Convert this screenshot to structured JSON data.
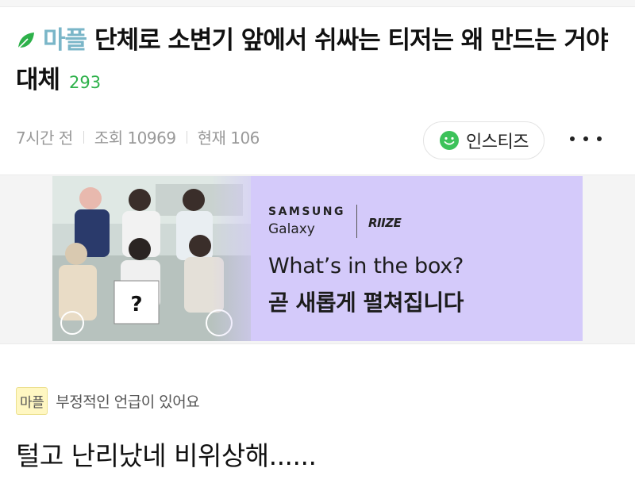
{
  "post": {
    "category": "마플",
    "title": "단체로 소변기 앞에서 쉬싸는 티저는 왜 만드는 거야 대체",
    "comment_count": "293",
    "meta": {
      "time": "7시간 전",
      "views": "조회 10969",
      "current": "현재 106"
    },
    "board_badge": "인스티즈",
    "notice_tag": "마플",
    "notice_text": "부정적인 언급이 있어요",
    "body": "털고 난리났네 비위상해......"
  },
  "ad": {
    "brand": "SAMSUNG",
    "sub_brand": "Galaxy",
    "partner": "RIIZE",
    "headline": "What’s in the box?",
    "subheadline": "곧 새롭게 펼쳐집니다",
    "box_mark": "?"
  },
  "colors": {
    "category": "#7ab6c8",
    "comment_count": "#2db14a",
    "ad_background": "#d4cafa",
    "notice_tag_bg": "#fff7c2"
  },
  "icons": {
    "leaf": "leaf-icon",
    "smile": "smile-icon",
    "more": "more-icon"
  }
}
